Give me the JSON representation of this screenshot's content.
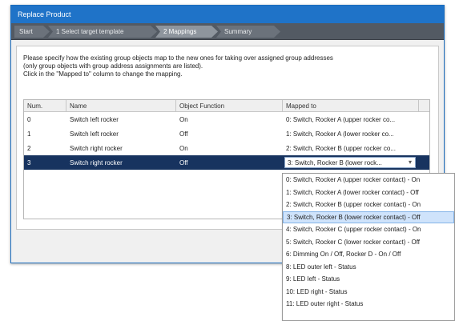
{
  "window": {
    "title": "Replace Product"
  },
  "wizard": {
    "steps": [
      {
        "label": "Start"
      },
      {
        "label": "1 Select target template"
      },
      {
        "label": "2 Mappings"
      },
      {
        "label": "Summary"
      }
    ],
    "active_step": "2 Mappings"
  },
  "instructions": {
    "line1": "Please specify how the existing group objects map to the new ones for taking over assigned group addresses",
    "line2": "(only group objects with group address assignments are listed).",
    "line3": "Click in the \"Mapped to\" column to change the mapping."
  },
  "table": {
    "columns": [
      "Num.",
      "Name",
      "Object Function",
      "Mapped to"
    ],
    "rows": [
      {
        "num": "0",
        "name": "Switch left rocker",
        "function": "On",
        "mapped": "0: Switch, Rocker A (upper rocker co..."
      },
      {
        "num": "1",
        "name": "Switch left rocker",
        "function": "Off",
        "mapped": "1: Switch, Rocker A (lower rocker co..."
      },
      {
        "num": "2",
        "name": "Switch right rocker",
        "function": "On",
        "mapped": "2: Switch, Rocker B (upper rocker co..."
      },
      {
        "num": "3",
        "name": "Switch right rocker",
        "function": "Off",
        "mapped": "3: Switch, Rocker B (lower rock..."
      }
    ],
    "selected_row": 3
  },
  "dropdown": {
    "options": [
      "0: Switch, Rocker A (upper rocker contact) - On",
      "1: Switch, Rocker A (lower rocker contact) - Off",
      "2: Switch, Rocker B (upper rocker contact) - On",
      "3: Switch, Rocker B (lower rocker contact) - Off",
      "4: Switch, Rocker C (upper rocker contact) - On",
      "5: Switch, Rocker C (lower rocker contact) - Off",
      "6: Dimming On / Off, Rocker D - On / Off",
      "8: LED outer left - Status",
      "9: LED left - Status",
      "10: LED right - Status",
      "11: LED outer right - Status"
    ],
    "highlighted_index": 3
  },
  "colors": {
    "title_bar": "#1f73c8",
    "wizard_bar": "#535a63",
    "selected_row": "#17335f",
    "dropdown_highlight": "#cfe3fb"
  }
}
